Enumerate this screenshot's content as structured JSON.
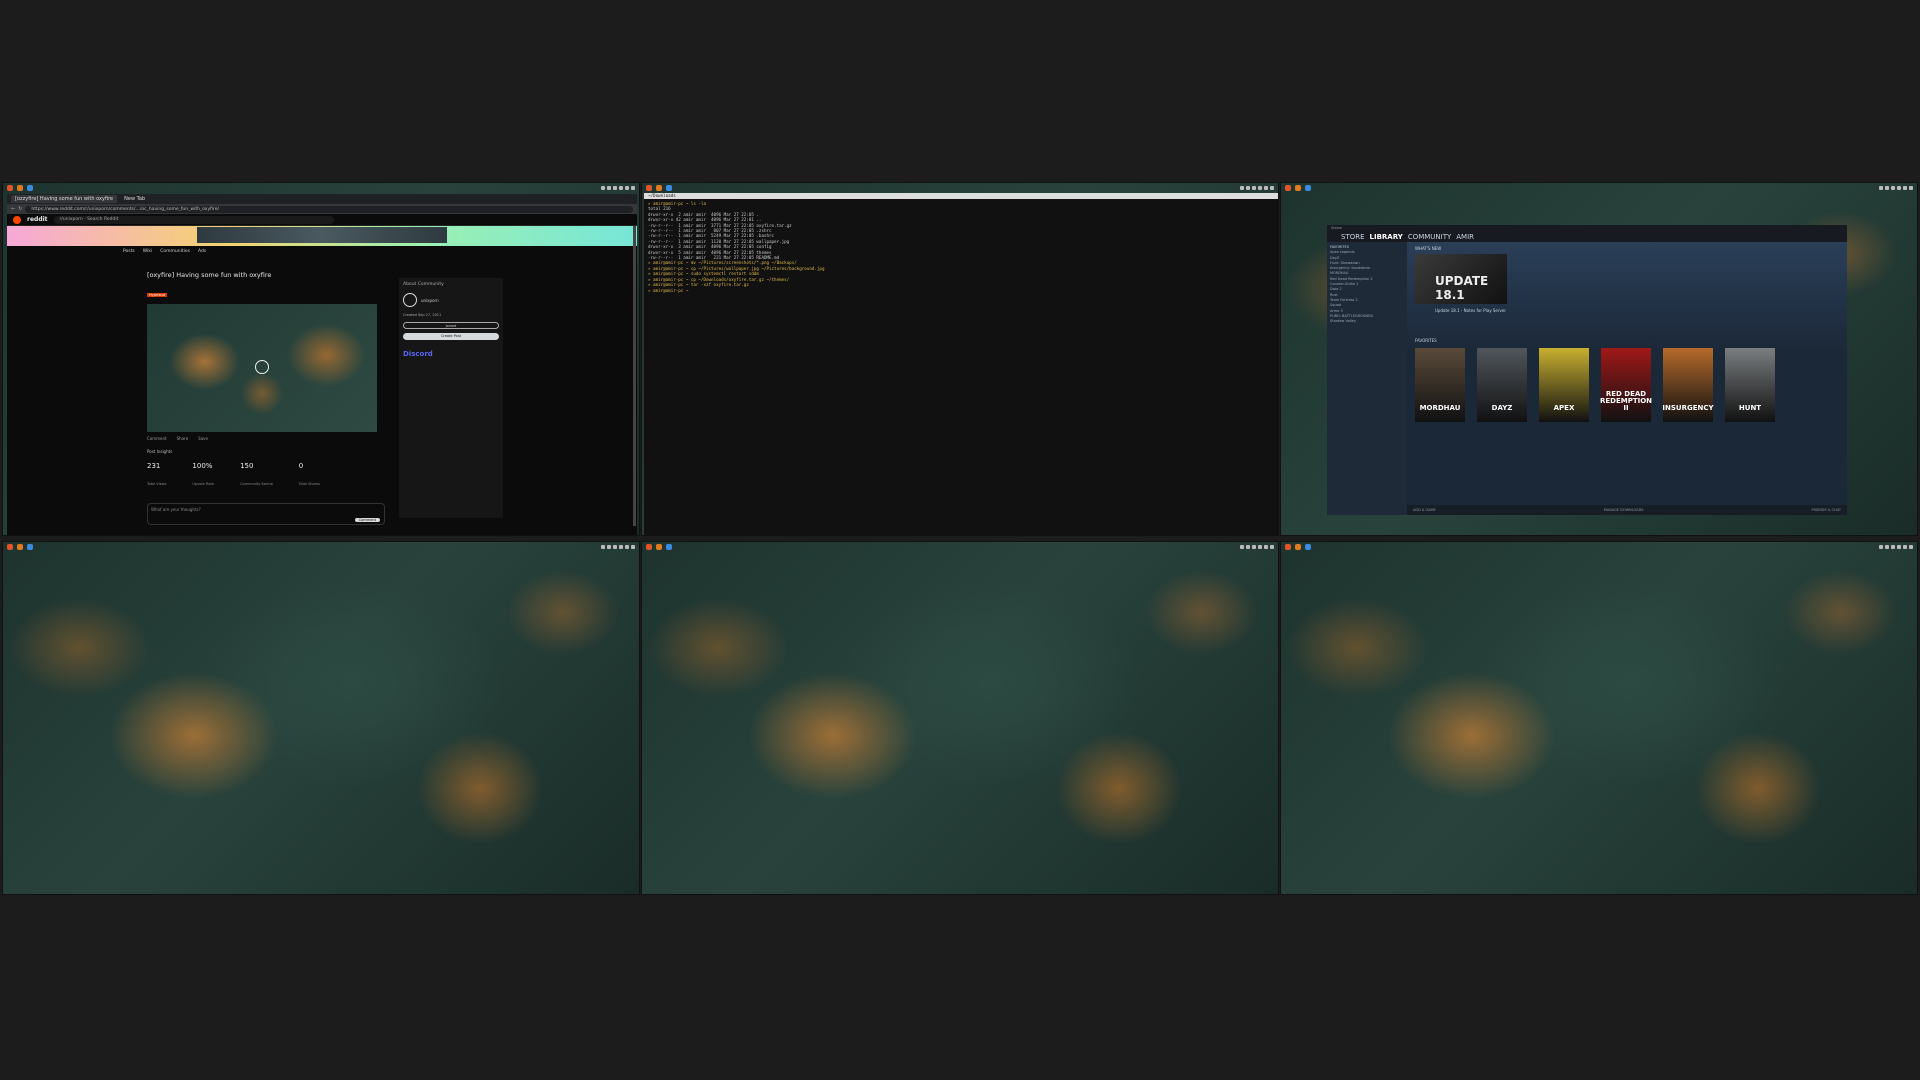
{
  "browser": {
    "tabs": [
      "[ozzyfire] Having some fun with oxyfire",
      "New Tab"
    ],
    "url": "https://www.reddit.com/r/unixporn/comments/…/oc_having_some_fun_with_oxyfire/",
    "brand": "reddit",
    "subreddit": "r/unixporn",
    "search_placeholder": "Search Reddit",
    "subnav": [
      "Posts",
      "Wiki",
      "Communities",
      "Ads"
    ],
    "post_title": "[oxyfire] Having some fun with oxyfire",
    "flair": "Hyprland",
    "actions": [
      "Comment",
      "Share",
      "Save"
    ],
    "insights_label": "Post Insights",
    "stats": [
      {
        "value": "231",
        "label": "Total Views"
      },
      {
        "value": "100%",
        "label": "Upvote Rate"
      },
      {
        "value": "150",
        "label": "Community Karma"
      },
      {
        "value": "0",
        "label": "Total Shares"
      }
    ],
    "comment_placeholder": "What are your thoughts?",
    "comment_button": "Comment",
    "sidebar": {
      "heading": "About Community",
      "name": "unixporn",
      "created": "Created Sep 27, 2011",
      "join_label": "Joined",
      "create_post": "Create Post",
      "discord": "Discord"
    }
  },
  "terminal": {
    "title": "~/Downloads",
    "lines": [
      "» amir@amir-pc ~ ls -la",
      "total 216",
      "drwxr-xr-x  2 amir amir  4096 Mar 27 22:05 .",
      "drwxr-xr-x 42 amir amir  4096 Mar 27 22:01 ..",
      "-rw-r--r--  1 amir amir  3771 Mar 27 22:05 oxyfire.tar.gz",
      "-rw-r--r--  1 amir amir   807 Mar 27 22:05 .zshrc",
      "-rw-r--r--  1 amir amir  5249 Mar 27 22:05 .bashrc",
      "-rw-r--r--  1 amir amir  1120 Mar 27 22:05 wallpaper.jpg",
      "drwxr-xr-x  3 amir amir  4096 Mar 27 22:05 config",
      "drwxr-xr-x  5 amir amir  4096 Mar 27 22:05 themes",
      "-rw-r--r--  1 amir amir   221 Mar 27 22:05 README.md",
      "» amir@amir-pc ~ mv ~/Pictures/screenshots/*.png ~/Backups/",
      "» amir@amir-pc ~ cp ~/Pictures/wallpaper.jpg ~/Pictures/background.jpg",
      "» amir@amir-pc ~ sudo systemctl restart sddm",
      "» amir@amir-pc ~ cp ~/Downloads/oxyfire.tar.gz ~/themes/",
      "» amir@amir-pc ~ tar -xzf oxyfire.tar.gz",
      "» amir@amir-pc ~ "
    ]
  },
  "steam": {
    "window_title": "Steam",
    "menu": [
      "STORE",
      "LIBRARY",
      "COMMUNITY",
      "AMIR"
    ],
    "active_menu": "LIBRARY",
    "whats_new": "WHAT'S NEW",
    "update_title": "UPDATE 18.1",
    "update_caption": "Update 18.1 - Notes for Play Server",
    "favorites_label": "FAVORITES",
    "sidebar_heading": "FAVORITES",
    "sidebar_items": [
      "Apex Legends",
      "DayZ",
      "Hunt: Showdown",
      "Insurgency: Sandstorm",
      "MORDHAU",
      "Red Dead Redemption 2",
      "Counter-Strike 2",
      "Dota 2",
      "Rust",
      "Team Fortress 2",
      "Squad",
      "Arma 3",
      "PUBG: BATTLEGROUNDS",
      "Stardew Valley"
    ],
    "games": [
      {
        "title": "MORDHAU",
        "color": "#5a4a3a"
      },
      {
        "title": "DAYZ",
        "color": "#50565c"
      },
      {
        "title": "APEX",
        "color": "#c8b030"
      },
      {
        "title": "RED DEAD REDEMPTION II",
        "color": "#a01818"
      },
      {
        "title": "INSURGENCY",
        "color": "#b46a2a"
      },
      {
        "title": "HUNT",
        "color": "#7a7e80"
      }
    ],
    "footer_left": "ADD A GAME",
    "footer_mid": "MANAGE DOWNLOADS",
    "footer_right": "FRIENDS & CHAT"
  }
}
